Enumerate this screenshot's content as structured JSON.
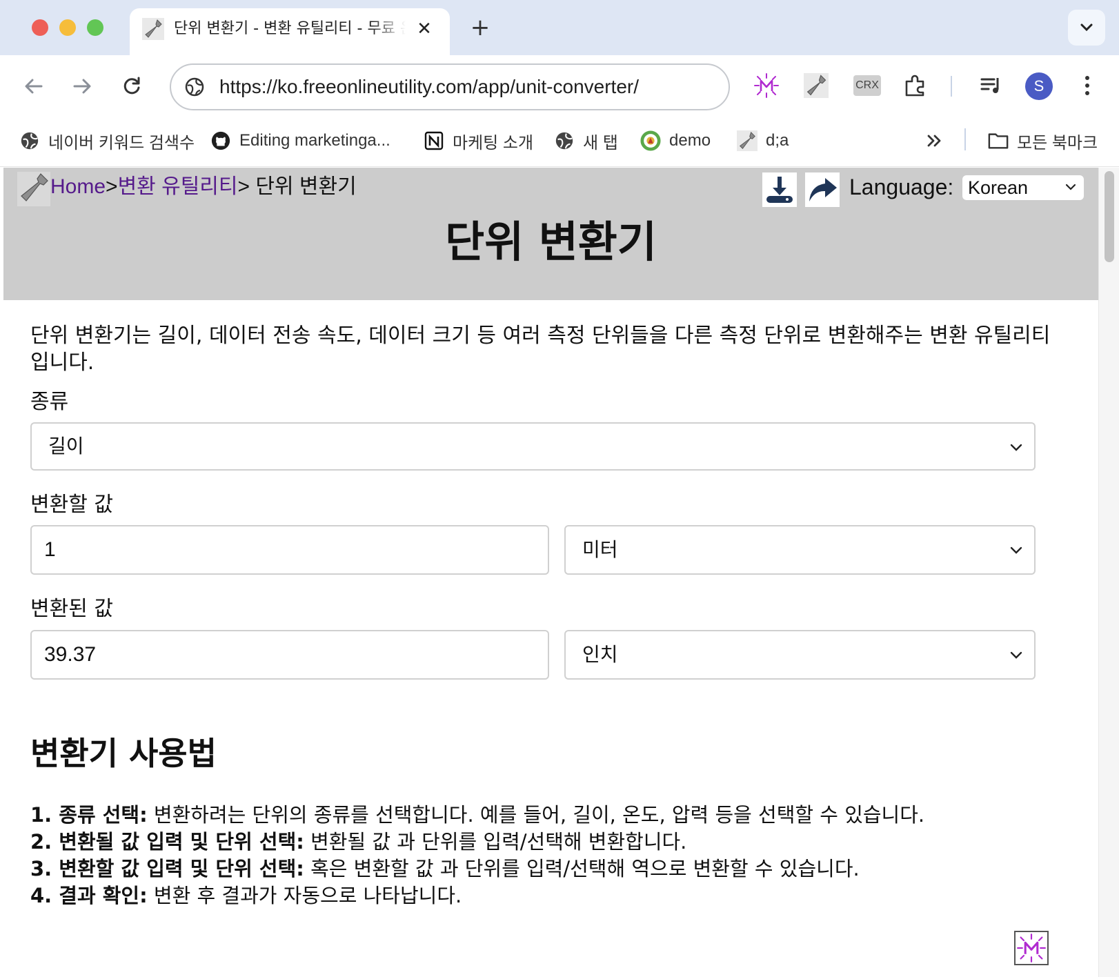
{
  "browser": {
    "tab": {
      "title": "단위 변환기 - 변환 유틸리티 - 무료 온라인 유틸리티"
    },
    "address": {
      "url": "https://ko.freeonlineutility.com/app/unit-converter/"
    },
    "extensions": [
      "sparkle-m-icon",
      "wrench-icon",
      "crx-icon",
      "puzzle-icon"
    ],
    "crx_label": "CRX",
    "profile_initial": "S",
    "bookmarks": [
      {
        "label": "네이버 키워드 검색수",
        "icon": "globe-icon"
      },
      {
        "label": "Editing marketinga...",
        "icon": "github-icon"
      },
      {
        "label": "마케팅 소개",
        "icon": "notion-icon"
      },
      {
        "label": "새 탭",
        "icon": "globe-icon"
      },
      {
        "label": "demo",
        "icon": "demo-icon"
      },
      {
        "label": "d;a",
        "icon": "wrench-icon"
      }
    ],
    "all_bookmarks_label": "모든 북마크"
  },
  "header": {
    "breadcrumb": {
      "home": "Home",
      "sep1": ">",
      "category": "변환 유틸리티",
      "sep2": ">",
      "current": " 단위 변환기"
    },
    "language_label": "Language:",
    "language_value": "Korean",
    "title": "단위 변환기"
  },
  "converter": {
    "intro": "단위 변환기는 길이, 데이터 전송 속도, 데이터 크기 등 여러 측정 단위들을 다른 측정 단위로 변환해주는 변환 유틸리티입니다.",
    "category_label": "종류",
    "category_value": "길이",
    "from_label": "변환할 값",
    "from_value": "1",
    "from_unit": "미터",
    "to_label": "변환된 값",
    "to_value": "39.37",
    "to_unit": "인치"
  },
  "howto": {
    "title": "변환기 사용법",
    "steps": [
      {
        "bold": "1. 종류 선택:",
        "text": " 변환하려는 단위의 종류를 선택합니다. 예를 들어, 길이, 온도, 압력 등을 선택할 수 있습니다."
      },
      {
        "bold": "2. 변환될 값 입력 및 단위 선택:",
        "text": " 변환될 값 과 단위를 입력/선택해 변환합니다."
      },
      {
        "bold": "3. 변환할 값 입력 및 단위 선택:",
        "text": " 혹은 변환할 값 과 단위를 입력/선택해 역으로 변환할 수 있습니다."
      },
      {
        "bold": "4. 결과 확인:",
        "text": " 변환 후 결과가 자동으로 나타납니다."
      }
    ]
  }
}
